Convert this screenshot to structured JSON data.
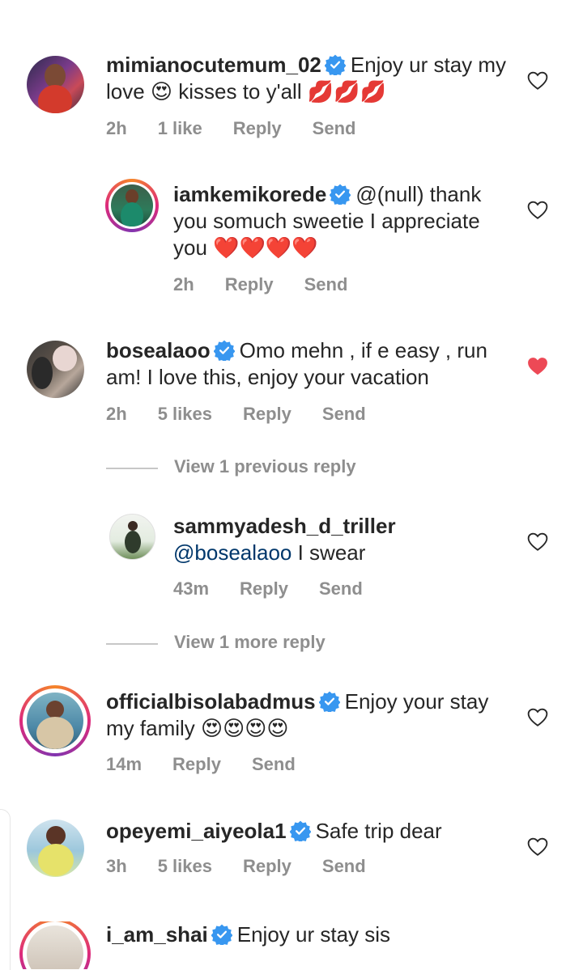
{
  "comments": [
    {
      "username": "mimianocutemum_02",
      "text": "Enjoy ur stay my love 😍 kisses to y'all 💋💋💋",
      "time": "2h",
      "likes": "1 like",
      "reply": "Reply",
      "send": "Send",
      "liked": false
    },
    {
      "username": "iamkemikorede",
      "text": "@(null) thank you somuch sweetie I appreciate you ❤️❤️❤️❤️",
      "time": "2h",
      "reply": "Reply",
      "send": "Send",
      "liked": false
    },
    {
      "username": "bosealaoo",
      "text": "Omo mehn , if e easy , run am! I love this, enjoy your vacation",
      "time": "2h",
      "likes": "5 likes",
      "reply": "Reply",
      "send": "Send",
      "liked": true
    },
    {
      "username": "sammyadesh_d_triller",
      "mention": "@bosealaoo",
      "text": " I swear",
      "time": "43m",
      "reply": "Reply",
      "send": "Send",
      "liked": false
    },
    {
      "username": "officialbisolabadmus",
      "text": "Enjoy your stay my family 😍😍😍😍",
      "time": "14m",
      "reply": "Reply",
      "send": "Send",
      "liked": false
    },
    {
      "username": "opeyemi_aiyeola1",
      "text": "Safe trip dear",
      "time": "3h",
      "likes": "5 likes",
      "reply": "Reply",
      "send": "Send",
      "liked": false
    },
    {
      "username": "i_am_shai",
      "text": "Enjoy ur stay sis"
    }
  ],
  "view_previous_replies": "View 1 previous reply",
  "view_more_replies": "View 1 more reply",
  "colors": {
    "verified": "#3897f0",
    "liked_heart": "#ed4956",
    "meta_text": "#8e8e8e",
    "mention": "#00376b"
  },
  "icons": {
    "verified": "verified-badge-icon",
    "like": "heart-outline-icon",
    "liked": "heart-filled-icon"
  }
}
